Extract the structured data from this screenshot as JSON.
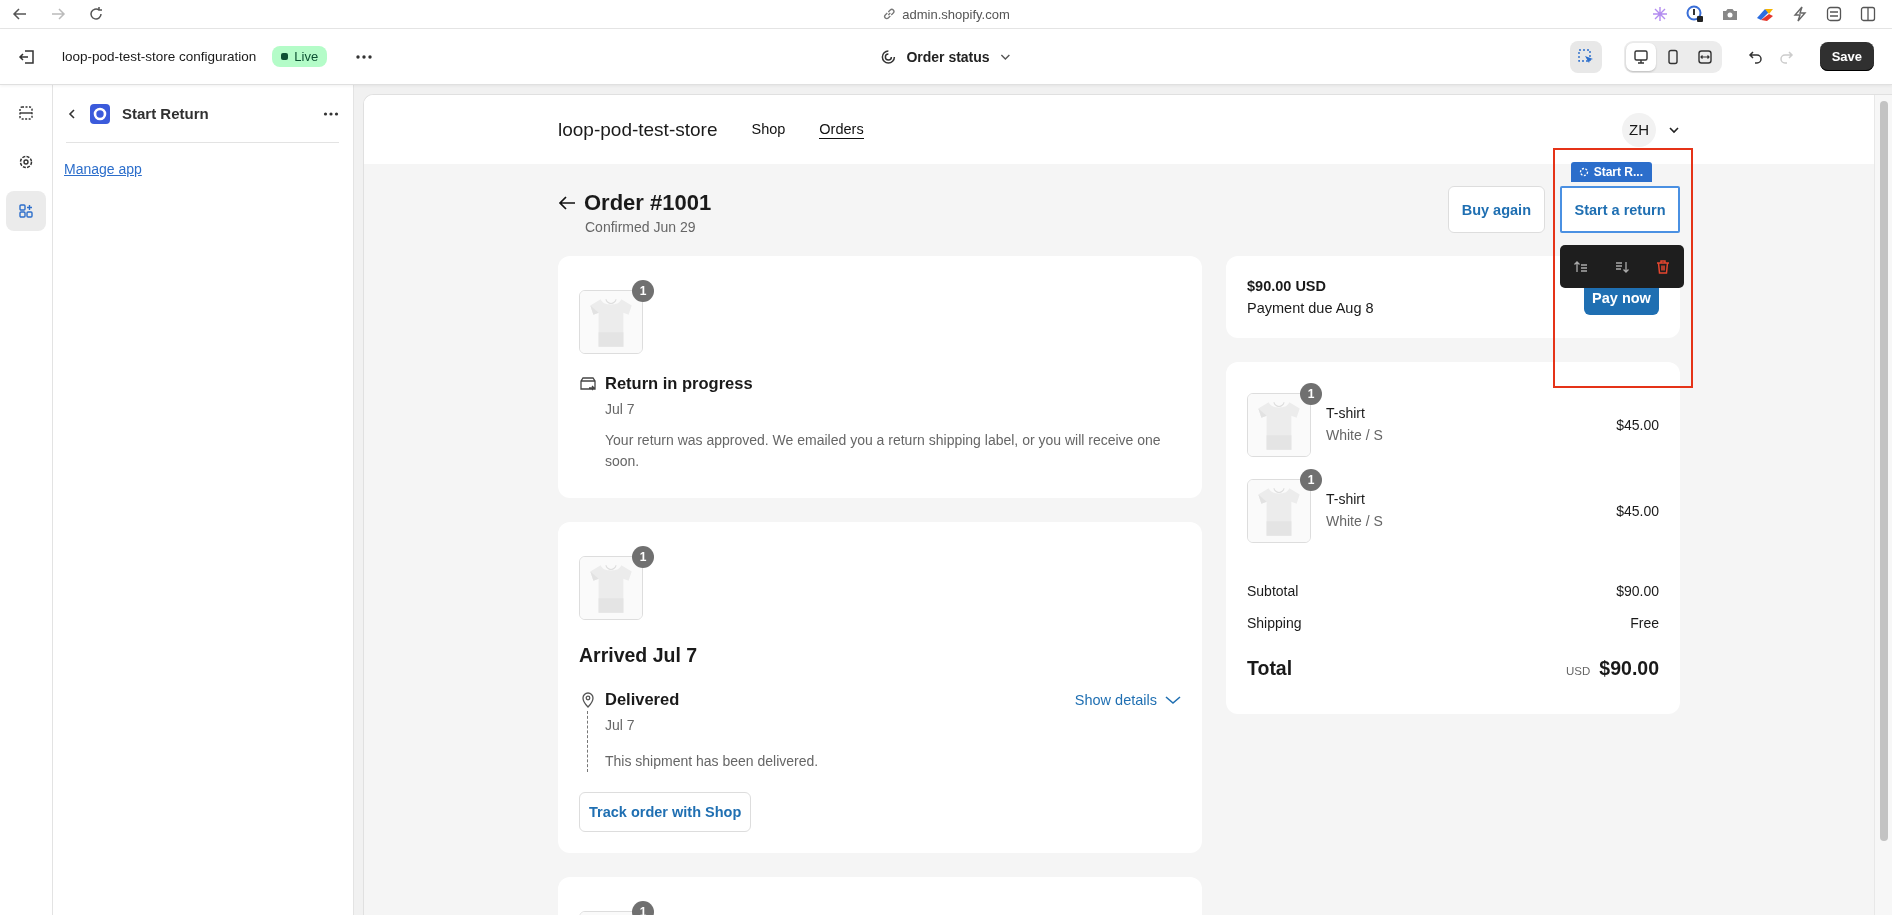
{
  "browser": {
    "url": "admin.shopify.com"
  },
  "editor": {
    "title": "loop-pod-test-store configuration",
    "status_badge": "Live",
    "template": "Order status",
    "inspect_mode": {
      "selected": true
    },
    "view_modes": [
      {
        "kind": "desktop",
        "selected": true
      },
      {
        "kind": "mobile",
        "selected": false
      },
      {
        "kind": "fullwidth",
        "selected": false
      }
    ],
    "redo": {
      "disabled": true
    },
    "save": "Save"
  },
  "rail": [
    {
      "kind": "sections",
      "selected": false
    },
    {
      "kind": "settings",
      "selected": false
    },
    {
      "kind": "apps",
      "selected": true
    }
  ],
  "sidebar": {
    "title": "Start Return",
    "link": "Manage app"
  },
  "preview": {
    "store_name": "loop-pod-test-store",
    "nav": [
      {
        "label": "Shop",
        "selected": false
      },
      {
        "label": "Orders",
        "selected": true
      }
    ],
    "account": "ZH",
    "order": {
      "title": "Order #1001",
      "confirmed": "Confirmed Jun 29",
      "buy_again": "Buy again",
      "start_return": "Start a return"
    },
    "block_overlay": {
      "tag": "Start R...",
      "highlighted": true
    },
    "return_card": {
      "quantity": "1",
      "title": "Return in progress",
      "date": "Jul 7",
      "message": "Your return was approved. We emailed you a return shipping label, or you will receive one soon."
    },
    "shipment_card": {
      "quantity": "1",
      "title": "Arrived Jul 7",
      "status": "Delivered",
      "show_details": "Show details",
      "date": "Jul 7",
      "message": "This shipment has been delivered.",
      "track": "Track order with Shop"
    },
    "third_card": {
      "quantity": "1"
    },
    "payment": {
      "amount": "$90.00 USD",
      "due": "Payment due Aug 8",
      "pay": "Pay now"
    },
    "items": [
      {
        "name": "T-shirt",
        "variant": "White / S",
        "price": "$45.00",
        "quantity": "1"
      },
      {
        "name": "T-shirt",
        "variant": "White / S",
        "price": "$45.00",
        "quantity": "1"
      }
    ],
    "summary": {
      "subtotal_label": "Subtotal",
      "subtotal": "$90.00",
      "shipping_label": "Shipping",
      "shipping": "Free",
      "total_label": "Total",
      "currency": "USD",
      "total": "$90.00"
    }
  }
}
